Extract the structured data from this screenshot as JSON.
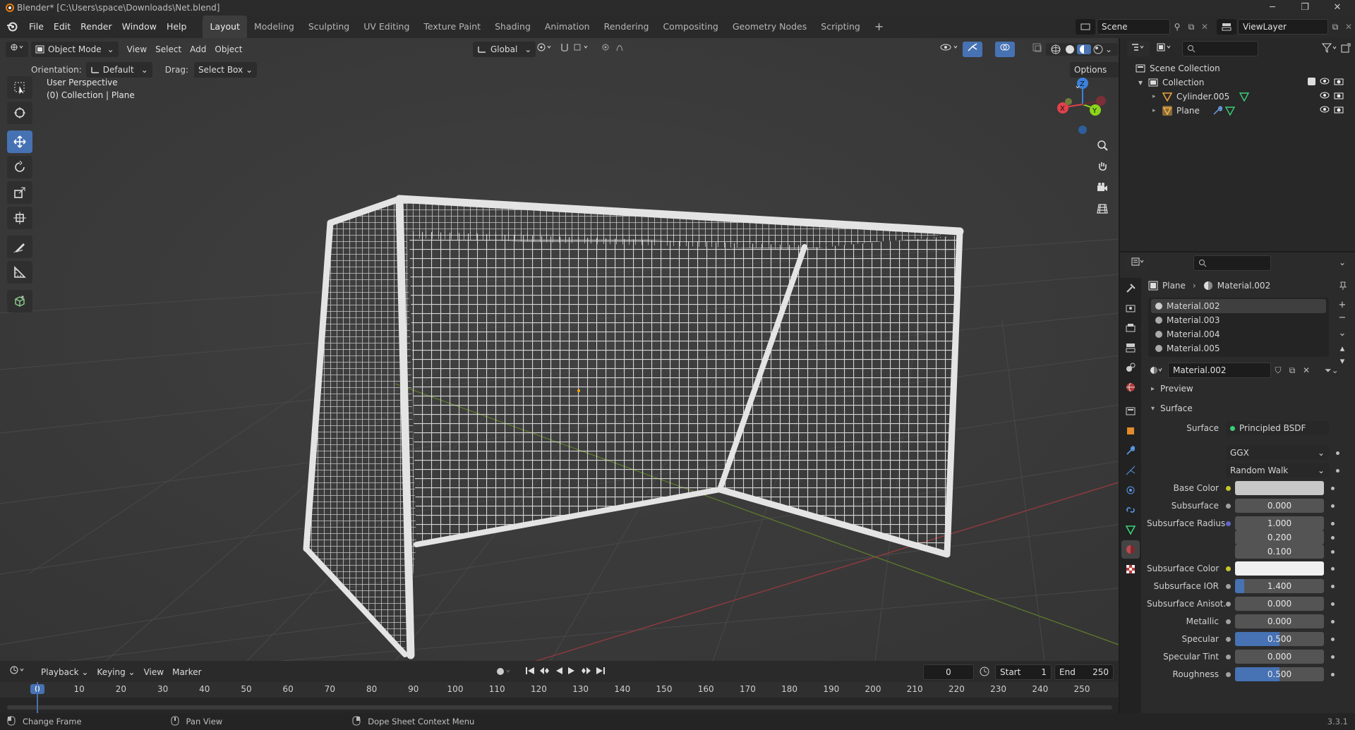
{
  "window": {
    "title": "Blender* [C:\\Users\\space\\Downloads\\Net.blend]"
  },
  "menubar": {
    "menus": [
      "File",
      "Edit",
      "Render",
      "Window",
      "Help"
    ],
    "workspaces": [
      "Layout",
      "Modeling",
      "Sculpting",
      "UV Editing",
      "Texture Paint",
      "Shading",
      "Animation",
      "Rendering",
      "Compositing",
      "Geometry Nodes",
      "Scripting"
    ],
    "active_workspace": "Layout",
    "scene": "Scene",
    "view_layer": "ViewLayer"
  },
  "viewport_header": {
    "mode": "Object Mode",
    "menus": [
      "View",
      "Select",
      "Add",
      "Object"
    ],
    "transform_orientation": "Global",
    "orientation_label": "Orientation:",
    "orientation_value": "Default",
    "drag_label": "Drag:",
    "drag_value": "Select Box",
    "options": "Options"
  },
  "viewport": {
    "perspective": "User Perspective",
    "collection_info": "(0) Collection | Plane",
    "gizmo_axes": [
      "X",
      "Y",
      "Z"
    ]
  },
  "timeline": {
    "menus": [
      "Playback",
      "Keying",
      "View",
      "Marker"
    ],
    "current_frame": "0",
    "start_label": "Start",
    "start_value": "1",
    "end_label": "End",
    "end_value": "250",
    "ruler": [
      "0",
      "10",
      "20",
      "30",
      "40",
      "50",
      "60",
      "70",
      "80",
      "90",
      "100",
      "110",
      "120",
      "130",
      "140",
      "150",
      "160",
      "170",
      "180",
      "190",
      "200",
      "210",
      "220",
      "230",
      "240",
      "250"
    ]
  },
  "statusbar": {
    "left": "Change Frame",
    "middle": "Pan View",
    "right": "Dope Sheet Context Menu",
    "version": "3.3.1"
  },
  "outliner": {
    "root": "Scene Collection",
    "collection": "Collection",
    "items": [
      "Cylinder.005",
      "Plane"
    ]
  },
  "properties": {
    "breadcrumb_object": "Plane",
    "breadcrumb_material": "Material.002",
    "material_slots": [
      "Material.002",
      "Material.003",
      "Material.004",
      "Material.005"
    ],
    "active_material": "Material.002",
    "panels": {
      "preview": "Preview",
      "surface": "Surface"
    },
    "surface_label": "Surface",
    "surface_value": "Principled BSDF",
    "distribution": "GGX",
    "subsurface_method": "Random Walk",
    "rows": [
      {
        "label": "Base Color",
        "type": "color",
        "value": "",
        "color": "#c8c8c8"
      },
      {
        "label": "Subsurface",
        "type": "num",
        "value": "0.000",
        "fill": 0
      },
      {
        "label": "Subsurface Radius",
        "type": "num",
        "value": "1.000",
        "fill": 0
      },
      {
        "label": "",
        "type": "num",
        "value": "0.200",
        "fill": 0
      },
      {
        "label": "",
        "type": "num",
        "value": "0.100",
        "fill": 0
      },
      {
        "label": "Subsurface Color",
        "type": "color",
        "value": "",
        "color": "#f0f0f0"
      },
      {
        "label": "Subsurface IOR",
        "type": "num",
        "value": "1.400",
        "fill": 0.1
      },
      {
        "label": "Subsurface Anisot...",
        "type": "num",
        "value": "0.000",
        "fill": 0
      },
      {
        "label": "Metallic",
        "type": "num",
        "value": "0.000",
        "fill": 0
      },
      {
        "label": "Specular",
        "type": "num",
        "value": "0.500",
        "fill": 0.5
      },
      {
        "label": "Specular Tint",
        "type": "num",
        "value": "0.000",
        "fill": 0
      },
      {
        "label": "Roughness",
        "type": "num",
        "value": "0.500",
        "fill": 0.5
      }
    ]
  },
  "colors": {
    "accent": "#4772b3",
    "viewport_bg": "#3a3a3a",
    "panel_bg": "#2b2b2b",
    "x_axis": "#e0414b",
    "y_axis": "#8bd31a",
    "z_axis": "#3b82de"
  }
}
